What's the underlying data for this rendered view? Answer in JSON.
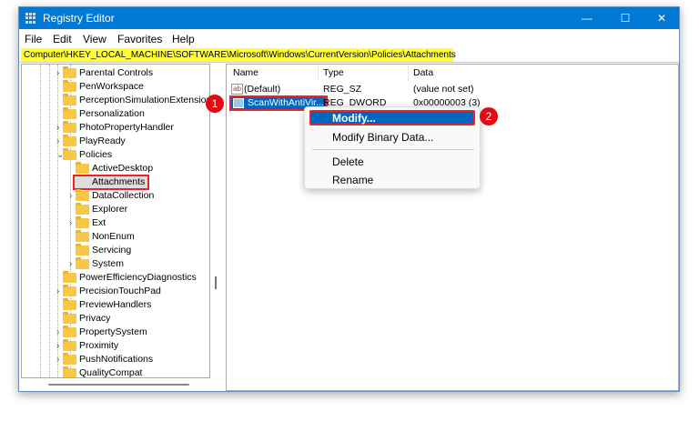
{
  "window": {
    "title": "Registry Editor",
    "minimize": "—",
    "maximize": "☐",
    "close": "✕"
  },
  "menu": [
    "File",
    "Edit",
    "View",
    "Favorites",
    "Help"
  ],
  "address": "Computer\\HKEY_LOCAL_MACHINE\\SOFTWARE\\Microsoft\\Windows\\CurrentVersion\\Policies\\Attachments",
  "tree": [
    {
      "label": "Parental Controls",
      "level": 0,
      "expander": "›"
    },
    {
      "label": "PenWorkspace",
      "level": 0,
      "expander": ""
    },
    {
      "label": "PerceptionSimulationExtensions",
      "level": 0,
      "expander": ""
    },
    {
      "label": "Personalization",
      "level": 0,
      "expander": ""
    },
    {
      "label": "PhotoPropertyHandler",
      "level": 0,
      "expander": "›"
    },
    {
      "label": "PlayReady",
      "level": 0,
      "expander": "›"
    },
    {
      "label": "Policies",
      "level": 0,
      "expander": "⌄"
    },
    {
      "label": "ActiveDesktop",
      "level": 1,
      "expander": ""
    },
    {
      "label": "Attachments",
      "level": 1,
      "expander": "",
      "selected": true
    },
    {
      "label": "DataCollection",
      "level": 1,
      "expander": "›"
    },
    {
      "label": "Explorer",
      "level": 1,
      "expander": ""
    },
    {
      "label": "Ext",
      "level": 1,
      "expander": "›"
    },
    {
      "label": "NonEnum",
      "level": 1,
      "expander": ""
    },
    {
      "label": "Servicing",
      "level": 1,
      "expander": ""
    },
    {
      "label": "System",
      "level": 1,
      "expander": "›"
    },
    {
      "label": "PowerEfficiencyDiagnostics",
      "level": 0,
      "expander": ""
    },
    {
      "label": "PrecisionTouchPad",
      "level": 0,
      "expander": "›"
    },
    {
      "label": "PreviewHandlers",
      "level": 0,
      "expander": ""
    },
    {
      "label": "Privacy",
      "level": 0,
      "expander": ""
    },
    {
      "label": "PropertySystem",
      "level": 0,
      "expander": "›"
    },
    {
      "label": "Proximity",
      "level": 0,
      "expander": "›"
    },
    {
      "label": "PushNotifications",
      "level": 0,
      "expander": "›"
    },
    {
      "label": "QualityCompat",
      "level": 0,
      "expander": ""
    }
  ],
  "columns": {
    "name": "Name",
    "type": "Type",
    "data": "Data"
  },
  "values": [
    {
      "name": "(Default)",
      "type": "REG_SZ",
      "data": "(value not set)",
      "icon": "ab"
    },
    {
      "name": "ScanWithAntiVir...",
      "type": "REG_DWORD",
      "data": "0x00000003 (3)",
      "icon": "dword"
    }
  ],
  "context_menu": [
    "Modify...",
    "Modify Binary Data...",
    "Delete",
    "Rename"
  ],
  "badges": [
    "1",
    "2"
  ],
  "colors": {
    "accent": "#0078d4",
    "highlight": "#ffff33",
    "badge": "#e50914"
  }
}
